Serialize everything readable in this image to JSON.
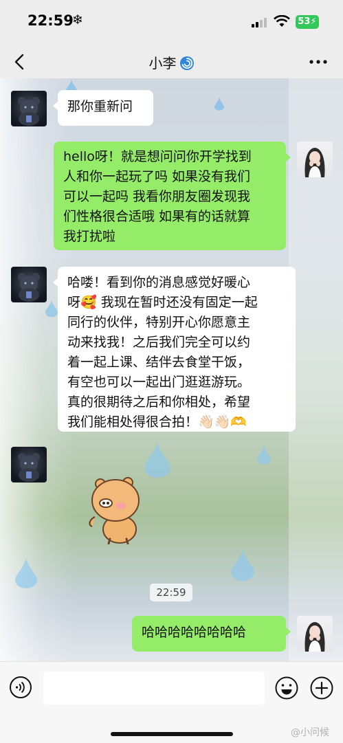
{
  "status_bar": {
    "time": "22:59",
    "weather_icon": "snowflake-icon",
    "battery_level": "53"
  },
  "nav": {
    "title": "小李",
    "title_emoji": "cyclone-emoji"
  },
  "messages": [
    {
      "side": "left",
      "text": "那你重新问"
    },
    {
      "side": "right",
      "text": "hello呀！就是想问问你开学找到人和你一起玩了吗 如果没有我们可以一起吗 我看你朋友圈发现我们性格很合适哦 如果有的话就算我打扰啦"
    },
    {
      "side": "left",
      "lines": [
        "哈喽！看到你的消息感觉好暖心",
        "呀🥰 我现在暂时还没有固定一起",
        "同行的伙伴，特别开心你愿意主",
        "动来找我！之后我们完全可以约",
        "着一起上课、结伴去食堂干饭，",
        "有空也可以一起出门逛逛游玩。",
        "真的很期待之后和你相处，希望",
        "我们能相处得很合拍！👋🏻👋🏻🫶"
      ]
    },
    {
      "side": "left",
      "type": "sticker",
      "sticker": "bear-sticker"
    },
    {
      "side": "right",
      "text": "哈哈哈哈哈哈哈哈"
    }
  ],
  "right_message_lines": [
    "hello呀！就是想问问你开学找到",
    "人和你一起玩了吗 如果没有我们",
    "可以一起吗 我看你朋友圈发现我",
    "们性格很合适哦 如果有的话就算",
    "我打扰啦"
  ],
  "timestamp": "22:59",
  "watermark": "@小问候"
}
